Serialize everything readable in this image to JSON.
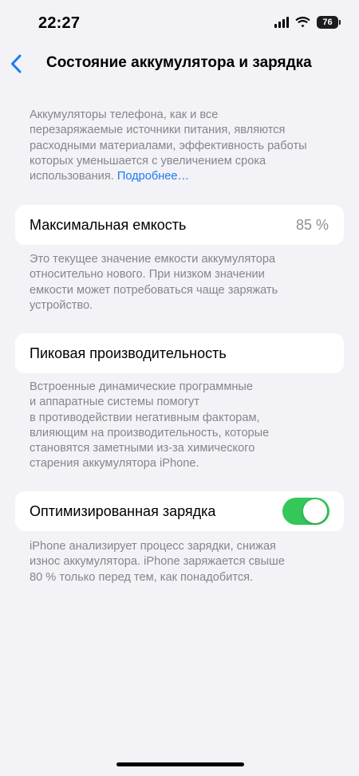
{
  "status_bar": {
    "time": "22:27",
    "battery_level": "76",
    "icons": [
      "signal-icon",
      "wifi-icon",
      "battery-icon"
    ]
  },
  "nav": {
    "back_icon": "chevron-left-icon",
    "title": "Состояние аккумулятора и зарядка"
  },
  "intro": {
    "lines": [
      "Аккумуляторы телефона, как и все",
      "перезаряжаемые источники питания, являются",
      "расходными материалами, эффективность работы",
      "которых уменьшается с увеличением срока",
      "использования."
    ],
    "link_label": "Подробнее…"
  },
  "max_capacity": {
    "label": "Максимальная емкость",
    "value": "85 %",
    "footer_lines": [
      "Это текущее значение емкости аккумулятора",
      "относительно нового. При низком значении",
      "емкости может потребоваться чаще заряжать",
      "устройство."
    ]
  },
  "peak_performance": {
    "label": "Пиковая производительность",
    "footer_lines": [
      "Встроенные динамические программные",
      "и аппаратные системы помогут",
      "в противодействии негативным факторам,",
      "влияющим на производительность, которые",
      "становятся заметными из-за химического",
      "старения аккумулятора iPhone."
    ]
  },
  "optimized_charging": {
    "label": "Оптимизированная зарядка",
    "enabled": true,
    "footer_lines": [
      "iPhone анализирует процесс зарядки, снижая",
      "износ аккумулятора. iPhone заряжается свыше",
      "80 % только перед тем, как понадобится."
    ]
  },
  "colors": {
    "background": "#f2f2f7",
    "accent": "#1a7cf0",
    "toggle_on": "#34c759",
    "secondary_text": "#85858b"
  }
}
